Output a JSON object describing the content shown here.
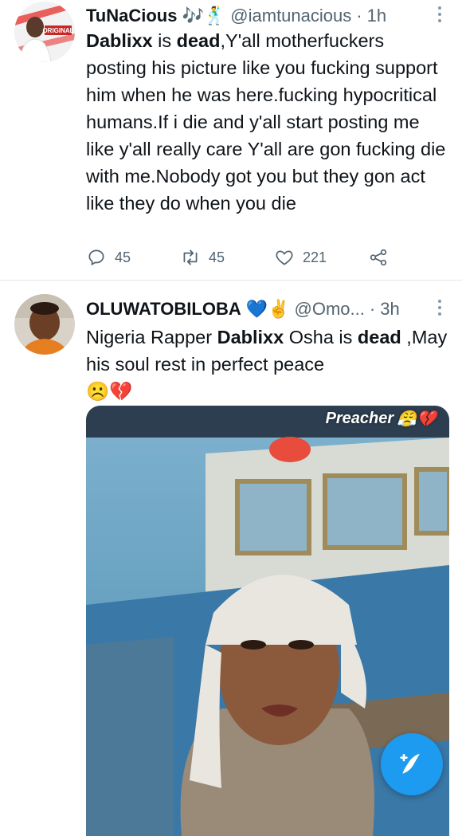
{
  "tweets": [
    {
      "name": "TuNaCious",
      "name_emoji": "🎶🕺",
      "handle": "@iamtunacious",
      "time": "1h",
      "text_parts": [
        {
          "text": "Dablixx",
          "bold": true
        },
        {
          "text": " is ",
          "bold": false
        },
        {
          "text": "dead",
          "bold": true
        },
        {
          "text": ",Y'all motherfuckers posting his picture like you fucking support him when he was here.fucking hypocritical humans.If i die and y'all start posting me like y'all really care Y'all are gon fucking die with me.Nobody got you but they gon act like they do when you die",
          "bold": false
        }
      ],
      "avatar_text": "ORIGINAL",
      "actions": {
        "reply_count": "45",
        "retweet_count": "45",
        "like_count": "221"
      }
    },
    {
      "name": "OLUWATOBILOBA",
      "name_emoji": "💙✌️",
      "handle": "@Omo...",
      "time": "3h",
      "text_parts": [
        {
          "text": "Nigeria Rapper ",
          "bold": false
        },
        {
          "text": "Dablixx",
          "bold": true
        },
        {
          "text": " Osha is ",
          "bold": false
        },
        {
          "text": "dead",
          "bold": true
        },
        {
          "text": " ,May his soul rest in perfect peace",
          "bold": false
        }
      ],
      "text_emoji": "☹️💔",
      "media": {
        "caption": "Preacher",
        "caption_emoji": "😤💔"
      }
    }
  ],
  "colors": {
    "accent": "#1d9bf0",
    "secondary_text": "#536471",
    "divider": "#e1e8ed"
  },
  "icons": {
    "reply": "reply-icon",
    "retweet": "retweet-icon",
    "like": "heart-icon",
    "share": "share-icon",
    "compose": "compose-tweet-icon"
  }
}
